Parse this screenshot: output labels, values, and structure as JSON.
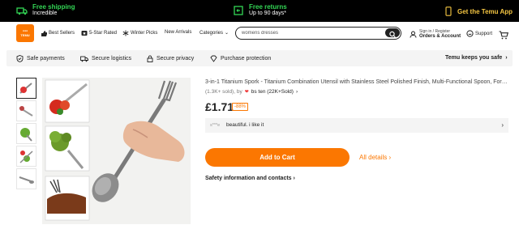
{
  "promo": {
    "shipping_title": "Free shipping",
    "shipping_sub": "Incredible",
    "returns_title": "Free returns",
    "returns_sub": "Up to 90 days*",
    "app_label": "Get the Temu App"
  },
  "header": {
    "logo_text": "TEMU",
    "nav": [
      "Best Sellers",
      "5-Star Rated",
      "Winter Picks",
      "New Arrivals",
      "Categories"
    ],
    "search_value": "womens dresses",
    "account_line1": "Sign in / Register",
    "account_line2": "Orders & Account",
    "support_label": "Support"
  },
  "trust": {
    "items": [
      "Safe payments",
      "Secure logistics",
      "Secure privacy",
      "Purchase protection"
    ],
    "keeps_safe": "Temu keeps you safe"
  },
  "product": {
    "title": "3-in-1 Titanium Spork - Titanium Combination Utensil with Stainless Steel Polished Finish, Multi-Functional Spoon, Fork, an...",
    "sold": "(1.3K+ sold), by",
    "store": "bs ten (22K+Sold)",
    "price": "£1.71",
    "discount": "-88%",
    "review_user": "s***e",
    "review_text": "beautiful. i like it",
    "add_to_cart": "Add to Cart",
    "all_details": "All details",
    "safety_link": "Safety information and contacts"
  },
  "colors": {
    "accent": "#fb7701",
    "promo_green": "#33d655",
    "promo_bg": "#000000"
  }
}
